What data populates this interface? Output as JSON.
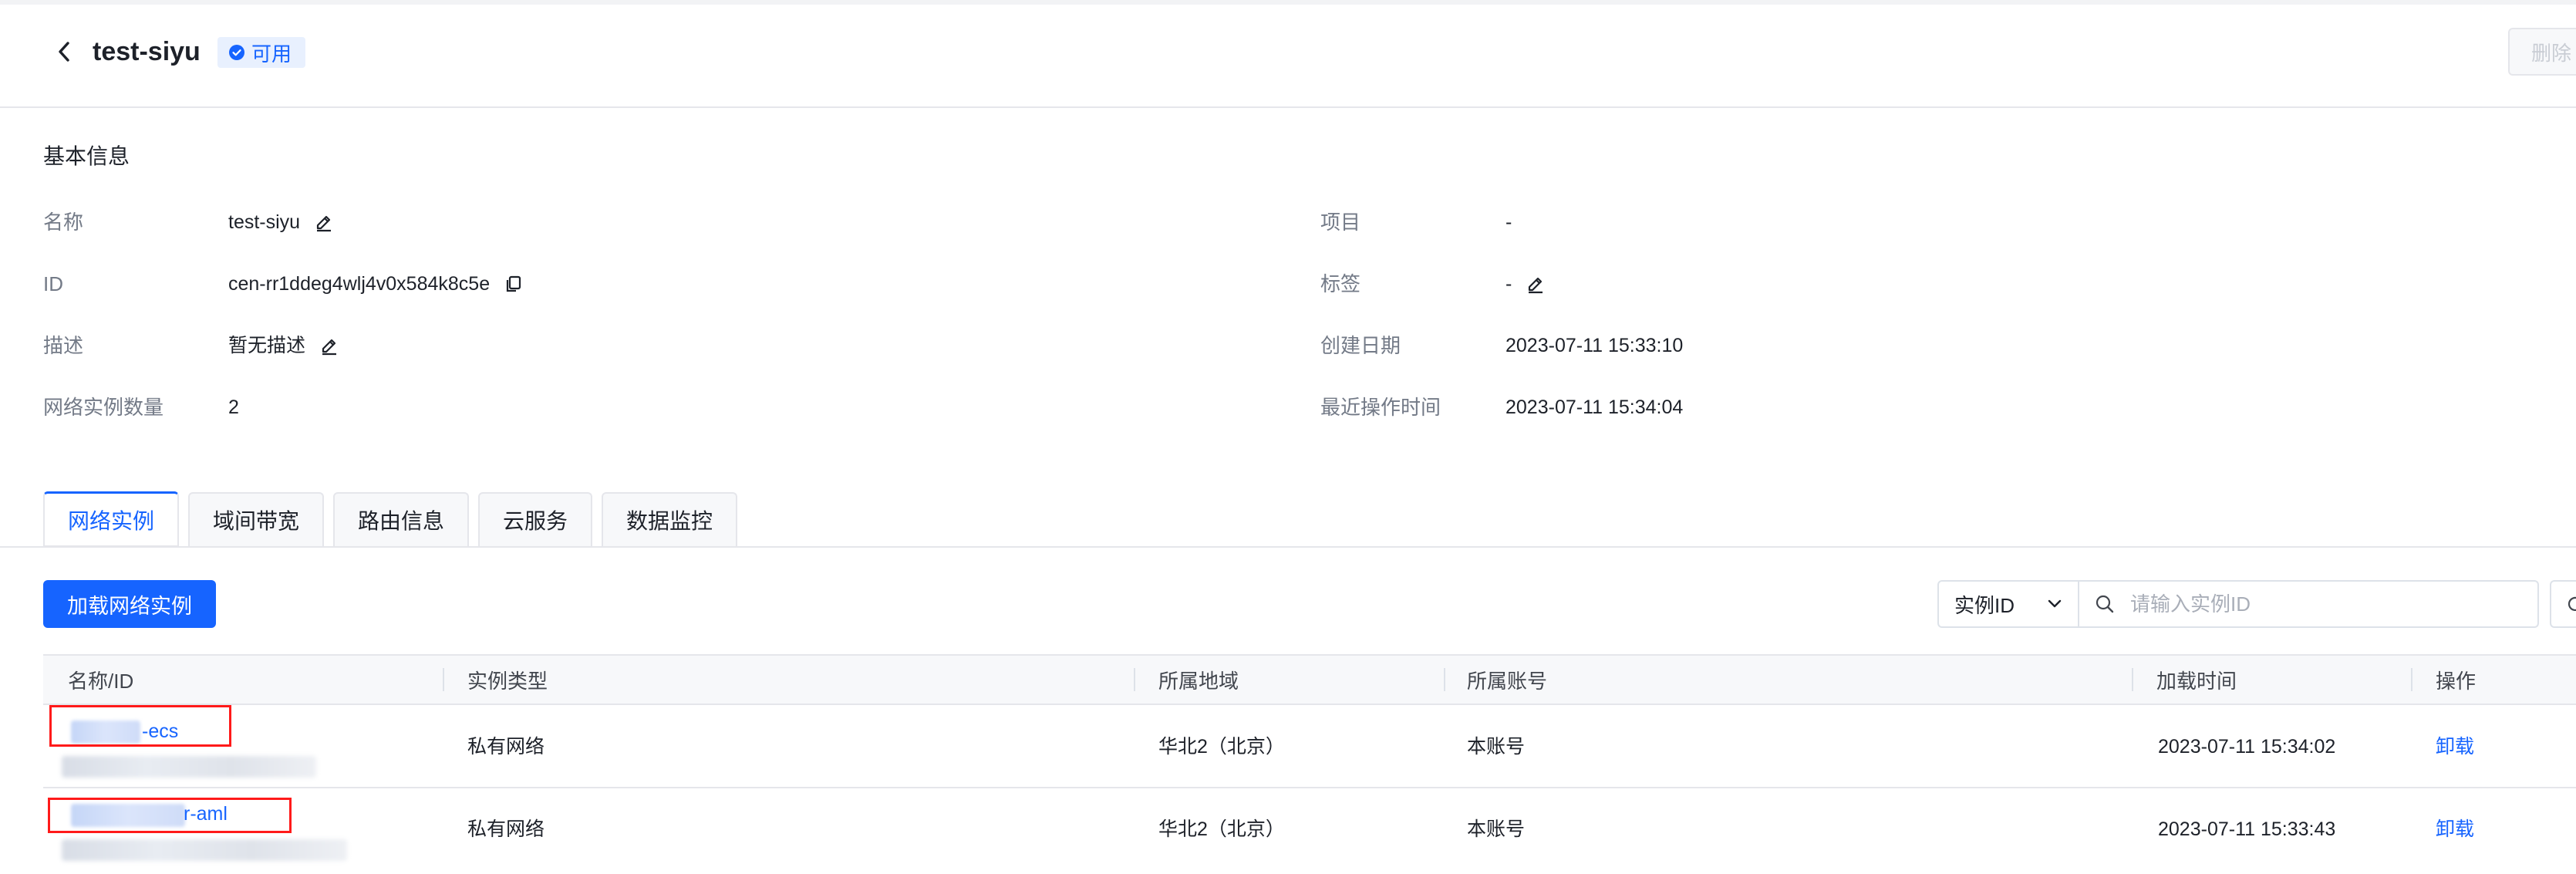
{
  "header": {
    "title": "test-siyu",
    "status": "可用",
    "delete_label": "删除"
  },
  "basic_info": {
    "section_title": "基本信息",
    "name_label": "名称",
    "name_value": "test-siyu",
    "id_label": "ID",
    "id_value": "cen-rr1ddeg4wlj4v0x584k8c5e",
    "desc_label": "描述",
    "desc_value": "暂无描述",
    "count_label": "网络实例数量",
    "count_value": "2",
    "project_label": "项目",
    "project_value": "-",
    "tags_label": "标签",
    "tags_value": "-",
    "created_label": "创建日期",
    "created_value": "2023-07-11 15:33:10",
    "recent_label": "最近操作时间",
    "recent_value": "2023-07-11 15:34:04"
  },
  "tabs": [
    {
      "label": "网络实例",
      "active": true
    },
    {
      "label": "域间带宽",
      "active": false
    },
    {
      "label": "路由信息",
      "active": false
    },
    {
      "label": "云服务",
      "active": false
    },
    {
      "label": "数据监控",
      "active": false
    }
  ],
  "toolbar": {
    "load_button": "加载网络实例",
    "filter_select": "实例ID",
    "search_placeholder": "请输入实例ID"
  },
  "table": {
    "columns": [
      "名称/ID",
      "实例类型",
      "所属地域",
      "所属账号",
      "加载时间",
      "操作"
    ],
    "rows": [
      {
        "name_suffix": "-ecs",
        "type": "私有网络",
        "region": "华北2（北京）",
        "account": "本账号",
        "time": "2023-07-11 15:34:02",
        "action": "卸载"
      },
      {
        "name_suffix": "r-aml",
        "type": "私有网络",
        "region": "华北2（北京）",
        "account": "本账号",
        "time": "2023-07-11 15:33:43",
        "action": "卸载"
      }
    ]
  },
  "colors": {
    "accent": "#1664ff",
    "status_bg": "#e8f0fe",
    "highlight_box": "#ff1a1a"
  },
  "icons": [
    "back-icon",
    "check-circle-icon",
    "edit-icon",
    "copy-icon",
    "chevron-down-icon",
    "search-icon",
    "refresh-icon"
  ]
}
